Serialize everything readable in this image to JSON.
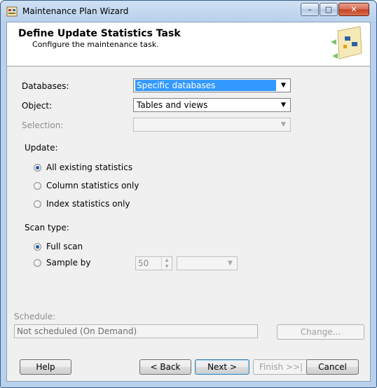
{
  "window": {
    "title": "Maintenance Plan Wizard",
    "controls": {
      "minimize": "–",
      "maximize": "□",
      "close": "✕"
    }
  },
  "header": {
    "title": "Define Update Statistics Task",
    "subtitle": "Configure the maintenance task."
  },
  "form": {
    "databases_label": "Databases:",
    "databases_value": "Specific databases",
    "object_label": "Object:",
    "object_value": "Tables and views",
    "selection_label": "Selection:",
    "selection_value": "",
    "update_label": "Update:",
    "update_options": [
      {
        "label": "All existing statistics",
        "selected": true
      },
      {
        "label": "Column statistics only",
        "selected": false
      },
      {
        "label": "Index statistics only",
        "selected": false
      }
    ],
    "scan_type_label": "Scan type:",
    "scan_options": [
      {
        "label": "Full scan",
        "selected": true
      },
      {
        "label": "Sample by",
        "selected": false
      }
    ],
    "sample_value": "50",
    "sample_unit": ""
  },
  "schedule": {
    "label": "Schedule:",
    "value": "Not scheduled (On Demand)",
    "change_button": "Change..."
  },
  "footer": {
    "help": "Help",
    "back": "< Back",
    "next": "Next >",
    "finish": "Finish >>|",
    "cancel": "Cancel"
  },
  "colors": {
    "selection_highlight": "#3399ff",
    "title_bar": "#b9d1ec"
  }
}
